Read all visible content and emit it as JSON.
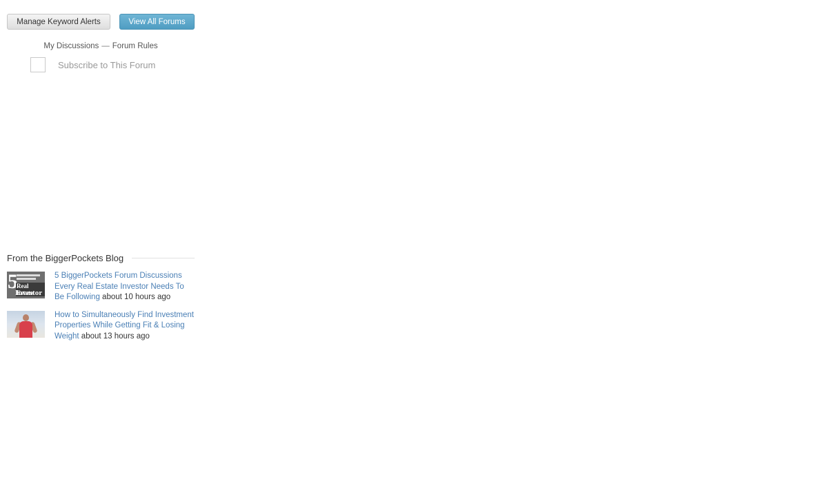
{
  "buttons": {
    "manage_alerts": "Manage Keyword Alerts",
    "view_forums": "View All Forums"
  },
  "links": {
    "my_discussions": "My Discussions",
    "separator": "—",
    "forum_rules": "Forum Rules"
  },
  "subscribe": {
    "label": "Subscribe to This Forum",
    "checked": false
  },
  "blog": {
    "heading": "From the BiggerPockets Blog",
    "posts": [
      {
        "title": "5 BiggerPockets Forum Discussions Every Real Estate Investor Needs To Be Following",
        "time": "about 10 hours ago",
        "thumbnail": "blog-thumbnail-real-estate-investor"
      },
      {
        "title": "How to Simultaneously Find Investment Properties While Getting Fit & Losing Weight",
        "time": "about 13 hours ago",
        "thumbnail": "blog-thumbnail-fitness"
      }
    ]
  },
  "colors": {
    "accent_button": "#5aa7cb",
    "link": "#4a7fb5"
  }
}
